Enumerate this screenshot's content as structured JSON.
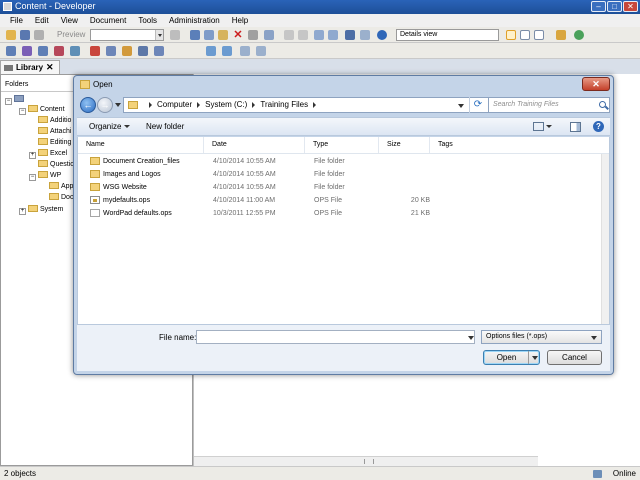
{
  "app": {
    "title": "Content - Developer",
    "menu": [
      "File",
      "Edit",
      "View",
      "Document",
      "Tools",
      "Administration",
      "Help"
    ],
    "toolbar": {
      "preview_label": "Preview",
      "view_mode": "Details view"
    }
  },
  "library": {
    "tab_label": "Library",
    "close_glyph": "✕",
    "folders_label": "Folders",
    "tree": [
      {
        "label": "",
        "level": 0,
        "expander": "−",
        "icon": "computer-icon"
      },
      {
        "label": "Content",
        "level": 1,
        "expander": "−"
      },
      {
        "label": "Additio",
        "level": 2,
        "expander": ""
      },
      {
        "label": "Attachi",
        "level": 2,
        "expander": ""
      },
      {
        "label": "Editing",
        "level": 2,
        "expander": ""
      },
      {
        "label": "Excel",
        "level": 2,
        "expander": "+"
      },
      {
        "label": "Questio",
        "level": 2,
        "expander": ""
      },
      {
        "label": "WP",
        "level": 2,
        "expander": "−"
      },
      {
        "label": "App",
        "level": 3,
        "expander": ""
      },
      {
        "label": "Doc",
        "level": 3,
        "expander": ""
      },
      {
        "label": "System",
        "level": 1,
        "expander": "+"
      }
    ]
  },
  "status": {
    "objects": "2 objects",
    "connection": "Online"
  },
  "dialog": {
    "title": "Open",
    "close_glyph": "✕",
    "breadcrumb": [
      "Computer",
      "System (C:)",
      "Training Files"
    ],
    "search_placeholder": "Search Training Files",
    "organize_label": "Organize",
    "new_folder_label": "New folder",
    "columns": [
      "Name",
      "Date",
      "Type",
      "Size",
      "Tags"
    ],
    "files": [
      {
        "name": "Document Creation_files",
        "date": "4/10/2014 10:55 AM",
        "type": "File folder",
        "size": "",
        "icon": "folder-icon"
      },
      {
        "name": "Images and Logos",
        "date": "4/10/2014 10:55 AM",
        "type": "File folder",
        "size": "",
        "icon": "folder-icon"
      },
      {
        "name": "WSG Website",
        "date": "4/10/2014 10:55 AM",
        "type": "File folder",
        "size": "",
        "icon": "folder-icon"
      },
      {
        "name": "mydefaults.ops",
        "date": "4/10/2014 11:00 AM",
        "type": "OPS File",
        "size": "20 KB",
        "icon": "ops-file-icon"
      },
      {
        "name": "WordPad defaults.ops",
        "date": "10/3/2011 12:55 PM",
        "type": "OPS File",
        "size": "21 KB",
        "icon": "file-icon"
      }
    ],
    "file_name_label": "File name:",
    "file_name_value": "",
    "file_type": "Options files (*.ops)",
    "open_label": "Open",
    "cancel_label": "Cancel"
  }
}
